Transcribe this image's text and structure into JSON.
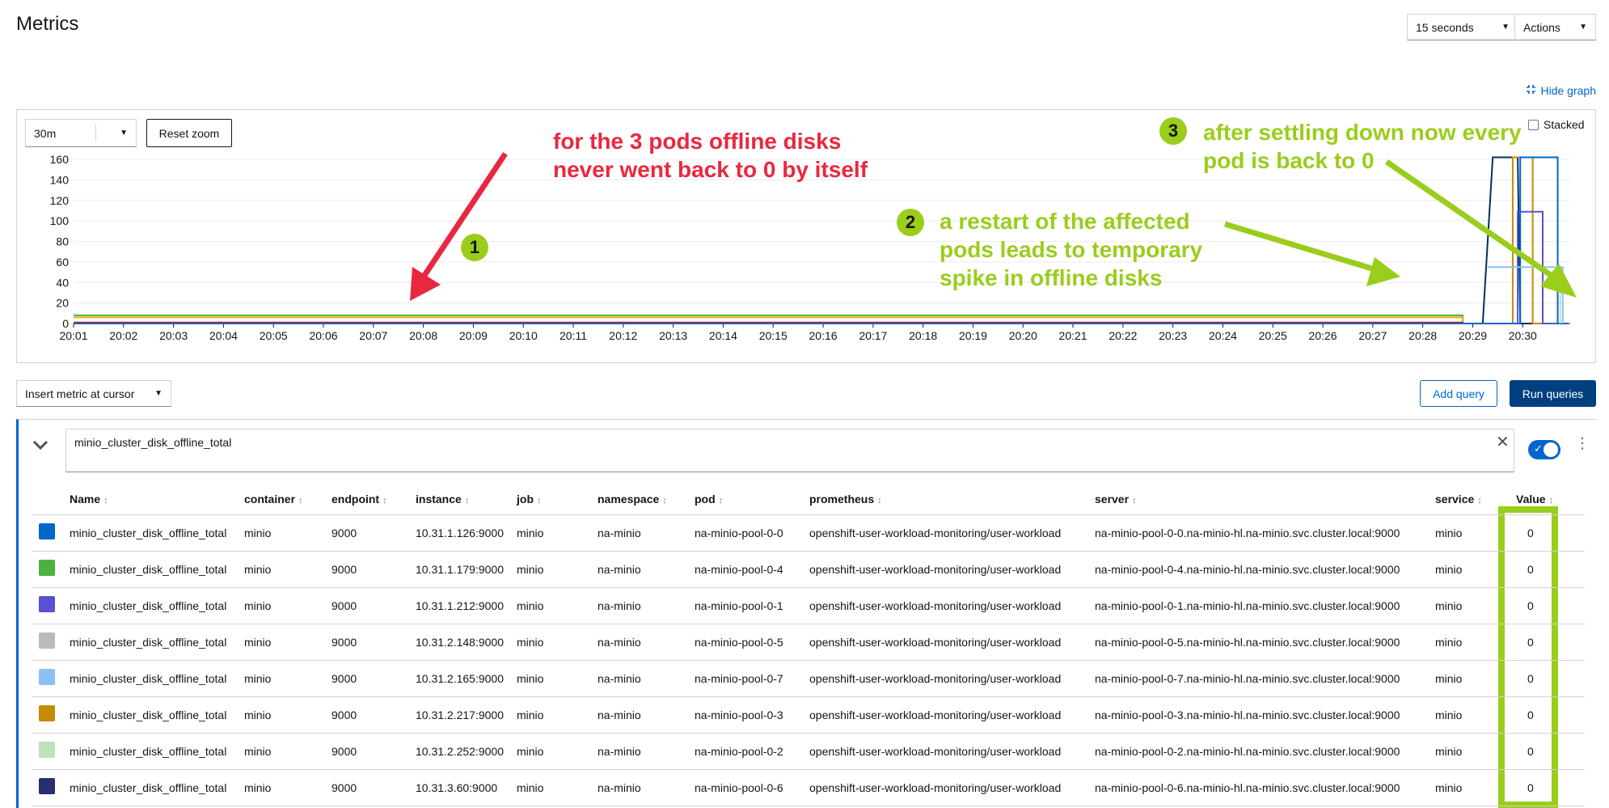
{
  "page": {
    "title": "Metrics"
  },
  "header": {
    "refresh_interval": "15 seconds",
    "actions_label": "Actions"
  },
  "graph_controls": {
    "hide_graph_label": "Hide graph",
    "time_range": "30m",
    "reset_zoom_label": "Reset zoom",
    "stacked_label": "Stacked"
  },
  "chart_data": {
    "type": "line",
    "ylim": [
      0,
      160
    ],
    "y_ticks": [
      "0",
      "20",
      "40",
      "60",
      "80",
      "100",
      "120",
      "140",
      "160"
    ],
    "x_ticks": [
      "20:01",
      "20:02",
      "20:03",
      "20:04",
      "20:05",
      "20:06",
      "20:07",
      "20:08",
      "20:09",
      "20:10",
      "20:11",
      "20:12",
      "20:13",
      "20:14",
      "20:15",
      "20:16",
      "20:17",
      "20:18",
      "20:19",
      "20:20",
      "20:21",
      "20:22",
      "20:23",
      "20:24",
      "20:25",
      "20:26",
      "20:27",
      "20:28",
      "20:29",
      "20:30"
    ],
    "series": [
      {
        "color": "#4cb140",
        "points": [
          [
            0,
            8
          ],
          [
            27.8,
            8
          ],
          [
            27.8,
            0
          ],
          [
            29.9,
            0
          ]
        ]
      },
      {
        "color": "#f0ab00",
        "points": [
          [
            0,
            6
          ],
          [
            27.8,
            6
          ],
          [
            27.8,
            0
          ],
          [
            29.9,
            0
          ]
        ]
      },
      {
        "color": "#c9190b",
        "points": [
          [
            0,
            1
          ],
          [
            27.8,
            1
          ],
          [
            27.8,
            0
          ],
          [
            29.9,
            0
          ]
        ]
      },
      {
        "color": "#002f5d",
        "points": [
          [
            0,
            0
          ],
          [
            28.2,
            0
          ],
          [
            28.4,
            162
          ],
          [
            28.9,
            162
          ],
          [
            28.95,
            0
          ],
          [
            29.9,
            0
          ]
        ]
      },
      {
        "color": "#c58c00",
        "points": [
          [
            0,
            0
          ],
          [
            28.8,
            0
          ],
          [
            28.8,
            162
          ],
          [
            29.2,
            162
          ],
          [
            29.2,
            0
          ],
          [
            29.9,
            0
          ]
        ]
      },
      {
        "color": "#5752d1",
        "points": [
          [
            0,
            0
          ],
          [
            28.9,
            0
          ],
          [
            28.9,
            109
          ],
          [
            29.4,
            109
          ],
          [
            29.4,
            0
          ],
          [
            29.9,
            0
          ]
        ]
      },
      {
        "color": "#06c",
        "points": [
          [
            0,
            0
          ],
          [
            28.95,
            0
          ],
          [
            28.95,
            162
          ],
          [
            29.7,
            162
          ],
          [
            29.7,
            0
          ],
          [
            29.9,
            0
          ]
        ]
      },
      {
        "color": "#8bc1f7",
        "points": [
          [
            28.3,
            55
          ],
          [
            29.8,
            55
          ],
          [
            29.8,
            0
          ]
        ]
      },
      {
        "color": "#bde2b9",
        "points": [
          [
            29.4,
            40
          ],
          [
            29.75,
            40
          ],
          [
            29.75,
            0
          ]
        ]
      }
    ]
  },
  "annotations": {
    "a1": {
      "number": "1",
      "text_line1": "for the 3 pods offline disks",
      "text_line2": "never went back to 0 by itself"
    },
    "a2": {
      "number": "2",
      "text_line1": "a restart of the affected",
      "text_line2": "pods leads to temporary",
      "text_line3": "spike in offline disks"
    },
    "a3": {
      "number": "3",
      "text_line1": "after settling down now every",
      "text_line2": "pod is back to 0"
    }
  },
  "query_bar": {
    "insert_metric_label": "Insert metric at cursor",
    "add_query_label": "Add query",
    "run_queries_label": "Run queries"
  },
  "query": {
    "expression": "minio_cluster_disk_offline_total"
  },
  "table": {
    "columns": [
      "Name",
      "container",
      "endpoint",
      "instance",
      "job",
      "namespace",
      "pod",
      "prometheus",
      "server",
      "service",
      "Value"
    ],
    "rows": [
      {
        "color": "#0066cc",
        "name": "minio_cluster_disk_offline_total",
        "container": "minio",
        "endpoint": "9000",
        "instance": "10.31.1.126:9000",
        "job": "minio",
        "namespace": "na-minio",
        "pod": "na-minio-pool-0-0",
        "prometheus": "openshift-user-workload-monitoring/user-workload",
        "server": "na-minio-pool-0-0.na-minio-hl.na-minio.svc.cluster.local:9000",
        "service": "minio",
        "value": "0"
      },
      {
        "color": "#4cb140",
        "name": "minio_cluster_disk_offline_total",
        "container": "minio",
        "endpoint": "9000",
        "instance": "10.31.1.179:9000",
        "job": "minio",
        "namespace": "na-minio",
        "pod": "na-minio-pool-0-4",
        "prometheus": "openshift-user-workload-monitoring/user-workload",
        "server": "na-minio-pool-0-4.na-minio-hl.na-minio.svc.cluster.local:9000",
        "service": "minio",
        "value": "0"
      },
      {
        "color": "#5752d1",
        "name": "minio_cluster_disk_offline_total",
        "container": "minio",
        "endpoint": "9000",
        "instance": "10.31.1.212:9000",
        "job": "minio",
        "namespace": "na-minio",
        "pod": "na-minio-pool-0-1",
        "prometheus": "openshift-user-workload-monitoring/user-workload",
        "server": "na-minio-pool-0-1.na-minio-hl.na-minio.svc.cluster.local:9000",
        "service": "minio",
        "value": "0"
      },
      {
        "color": "#b8bbbe",
        "name": "minio_cluster_disk_offline_total",
        "container": "minio",
        "endpoint": "9000",
        "instance": "10.31.2.148:9000",
        "job": "minio",
        "namespace": "na-minio",
        "pod": "na-minio-pool-0-5",
        "prometheus": "openshift-user-workload-monitoring/user-workload",
        "server": "na-minio-pool-0-5.na-minio-hl.na-minio.svc.cluster.local:9000",
        "service": "minio",
        "value": "0"
      },
      {
        "color": "#8bc1f7",
        "name": "minio_cluster_disk_offline_total",
        "container": "minio",
        "endpoint": "9000",
        "instance": "10.31.2.165:9000",
        "job": "minio",
        "namespace": "na-minio",
        "pod": "na-minio-pool-0-7",
        "prometheus": "openshift-user-workload-monitoring/user-workload",
        "server": "na-minio-pool-0-7.na-minio-hl.na-minio.svc.cluster.local:9000",
        "service": "minio",
        "value": "0"
      },
      {
        "color": "#c58c00",
        "name": "minio_cluster_disk_offline_total",
        "container": "minio",
        "endpoint": "9000",
        "instance": "10.31.2.217:9000",
        "job": "minio",
        "namespace": "na-minio",
        "pod": "na-minio-pool-0-3",
        "prometheus": "openshift-user-workload-monitoring/user-workload",
        "server": "na-minio-pool-0-3.na-minio-hl.na-minio.svc.cluster.local:9000",
        "service": "minio",
        "value": "0"
      },
      {
        "color": "#bde2b9",
        "name": "minio_cluster_disk_offline_total",
        "container": "minio",
        "endpoint": "9000",
        "instance": "10.31.2.252:9000",
        "job": "minio",
        "namespace": "na-minio",
        "pod": "na-minio-pool-0-2",
        "prometheus": "openshift-user-workload-monitoring/user-workload",
        "server": "na-minio-pool-0-2.na-minio-hl.na-minio.svc.cluster.local:9000",
        "service": "minio",
        "value": "0"
      },
      {
        "color": "#292e6c",
        "name": "minio_cluster_disk_offline_total",
        "container": "minio",
        "endpoint": "9000",
        "instance": "10.31.3.60:9000",
        "job": "minio",
        "namespace": "na-minio",
        "pod": "na-minio-pool-0-6",
        "prometheus": "openshift-user-workload-monitoring/user-workload",
        "server": "na-minio-pool-0-6.na-minio-hl.na-minio.svc.cluster.local:9000",
        "service": "minio",
        "value": "0"
      }
    ]
  }
}
